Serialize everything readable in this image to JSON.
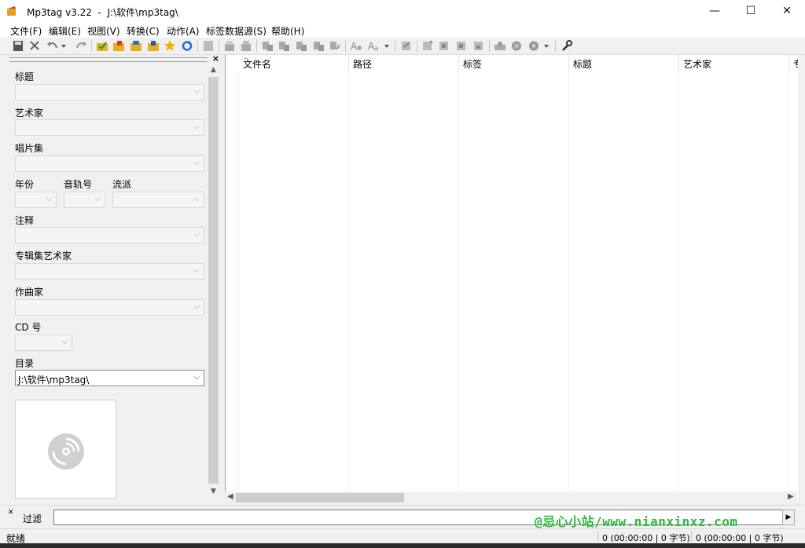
{
  "window": {
    "app_title": "Mp3tag v3.22",
    "path": "J:\\软件\\mp3tag\\",
    "minimize": "—",
    "maximize": "☐",
    "close": "✕"
  },
  "menu": [
    "文件(F)",
    "编辑(E)",
    "视图(V)",
    "转换(C)",
    "动作(A)",
    "标签数据源(S)",
    "帮助(H)"
  ],
  "toolbar_icons": [
    "save-icon",
    "delete-icon",
    "undo-icon",
    "dropdown-icon",
    "redo-icon",
    "folder-check-icon",
    "folder-add-icon",
    "folder-open-icon",
    "folder-save-icon",
    "star-icon",
    "refresh-icon",
    "tag-panel-icon",
    "copy-tag-icon",
    "paste-tag-icon",
    "tag-to-filename-icon",
    "filename-to-tag-icon",
    "tag-to-tag-icon",
    "text-file-icon",
    "filename-to-filename-icon",
    "case-icon",
    "format-icon",
    "dropdown-icon",
    "export-icon",
    "playlist-icon",
    "import-icon",
    "export-html-icon",
    "export-csv-icon",
    "cover-icon",
    "web-icon",
    "freedb-icon",
    "dropdown-icon",
    "settings-wrench-icon"
  ],
  "tag_panel": {
    "fields": {
      "title": "标题",
      "artist": "艺术家",
      "album": "唱片集",
      "year": "年份",
      "track": "音轨号",
      "genre": "流派",
      "comment": "注释",
      "album_artist": "专辑集艺术家",
      "composer": "作曲家",
      "disc": "CD 号",
      "directory": "目录"
    },
    "directory_value": "J:\\软件\\mp3tag\\"
  },
  "list": {
    "columns": [
      "文件名",
      "路径",
      "标签",
      "标题",
      "艺术家",
      "专"
    ]
  },
  "filter": {
    "label": "过滤",
    "value": "",
    "go": "▶"
  },
  "watermark": "@忌心小站/www.nianxinxz.com",
  "status": {
    "text": "就绪",
    "selected": "0 (00:00:00 | 0 字节)",
    "total": "0 (00:00:00 | 0 字节)"
  }
}
